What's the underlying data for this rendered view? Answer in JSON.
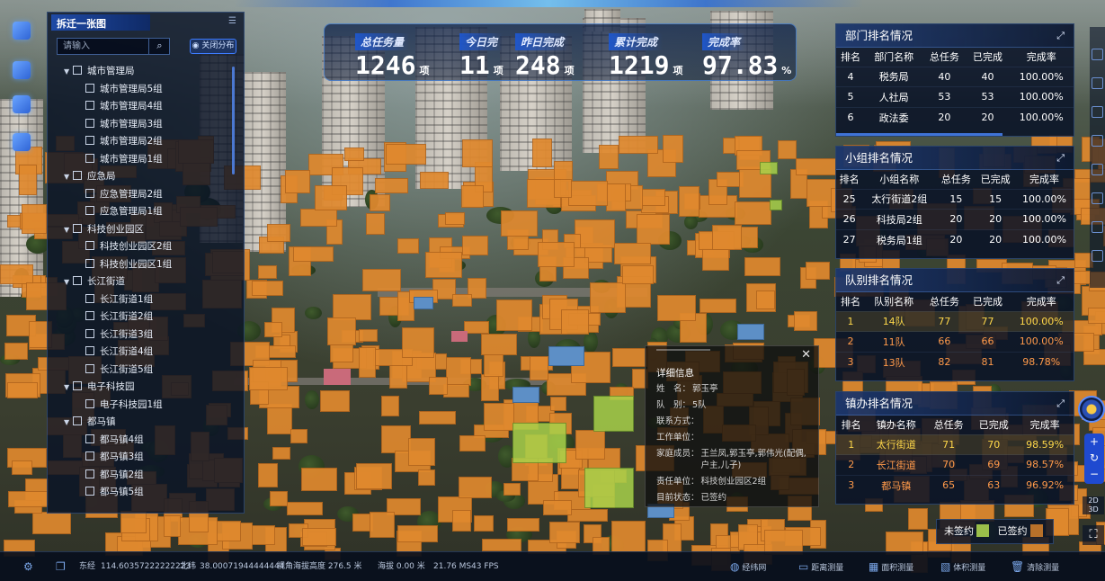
{
  "stats": {
    "items": [
      {
        "label": "总任务量",
        "value": "1246",
        "unit": "项"
      },
      {
        "label": "今日完",
        "value": "11",
        "unit": "项"
      },
      {
        "label": "昨日完成",
        "value": "248",
        "unit": "项"
      },
      {
        "label": "累计完成",
        "value": "1219",
        "unit": "项"
      },
      {
        "label": "完成率",
        "value": "97.83",
        "unit": "%"
      }
    ]
  },
  "tree": {
    "title": "拆迁一张图",
    "search_placeholder": "请输入",
    "close_button": "关闭分布",
    "groups": [
      {
        "label": "城市管理局",
        "children": [
          "城市管理局5组",
          "城市管理局4组",
          "城市管理局3组",
          "城市管理局2组",
          "城市管理局1组"
        ]
      },
      {
        "label": "应急局",
        "children": [
          "应急管理局2组",
          "应急管理局1组"
        ]
      },
      {
        "label": "科技创业园区",
        "children": [
          "科技创业园区2组",
          "科技创业园区1组"
        ]
      },
      {
        "label": "长江街道",
        "children": [
          "长江街道1组",
          "长江街道2组",
          "长江街道3组",
          "长江街道4组",
          "长江街道5组"
        ]
      },
      {
        "label": "电子科技园",
        "children": [
          "电子科技园1组"
        ]
      },
      {
        "label": "都马镇",
        "children": [
          "都马镇4组",
          "都马镇3组",
          "都马镇2组",
          "都马镇5组"
        ]
      }
    ]
  },
  "dept_rank": {
    "title": "部门排名情况",
    "headers": [
      "排名",
      "部门名称",
      "总任务",
      "已完成",
      "完成率"
    ],
    "rows": [
      [
        "4",
        "税务局",
        "40",
        "40",
        "100.00%"
      ],
      [
        "5",
        "人社局",
        "53",
        "53",
        "100.00%"
      ],
      [
        "6",
        "政法委",
        "20",
        "20",
        "100.00%"
      ]
    ]
  },
  "group_rank": {
    "title": "小组排名情况",
    "headers": [
      "排名",
      "小组名称",
      "总任务",
      "已完成",
      "完成率"
    ],
    "rows": [
      [
        "25",
        "太行街道2组",
        "15",
        "15",
        "100.00%"
      ],
      [
        "26",
        "科技局2组",
        "20",
        "20",
        "100.00%"
      ],
      [
        "27",
        "税务局1组",
        "20",
        "20",
        "100.00%"
      ]
    ]
  },
  "team_rank": {
    "title": "队别排名情况",
    "headers": [
      "排名",
      "队别名称",
      "总任务",
      "已完成",
      "完成率"
    ],
    "rows": [
      [
        "1",
        "14队",
        "77",
        "77",
        "100.00%"
      ],
      [
        "2",
        "11队",
        "66",
        "66",
        "100.00%"
      ],
      [
        "3",
        "13队",
        "82",
        "81",
        "98.78%"
      ]
    ]
  },
  "town_rank": {
    "title": "镇办排名情况",
    "headers": [
      "排名",
      "镇办名称",
      "总任务",
      "已完成",
      "完成率"
    ],
    "rows": [
      [
        "1",
        "太行街道",
        "71",
        "70",
        "98.59%"
      ],
      [
        "2",
        "长江街道",
        "70",
        "69",
        "98.57%"
      ],
      [
        "3",
        "都马镇",
        "65",
        "63",
        "96.92%"
      ]
    ]
  },
  "detail": {
    "title": "详细信息",
    "fields": [
      {
        "label": "姓　名：",
        "value": "郭玉亭"
      },
      {
        "label": "队　别：",
        "value": "5队"
      },
      {
        "label": "联系方式：",
        "value": ""
      },
      {
        "label": "工作单位：",
        "value": ""
      },
      {
        "label": "家庭成员：",
        "value": "王兰凤,郭玉亭,郭伟光(配偶,户主,儿子)"
      },
      {
        "label": "责任单位：",
        "value": "科技创业园区2组"
      },
      {
        "label": "目前状态：",
        "value": "已签约"
      }
    ]
  },
  "legend": {
    "unsigned_label": "未签约",
    "unsigned_color": "#9bbf4a",
    "signed_label": "已签约",
    "signed_color": "#b8712a"
  },
  "status_bar": {
    "lon_label": "东经",
    "lon_value": "114.60357222222223",
    "lat_label": "北纬",
    "lat_value": "38.00071944444444",
    "view_alt": "视角海拔高度 276.5 米",
    "alt": "海拔 0.00 米",
    "ms": "21.76 MS",
    "fps": "43 FPS",
    "tools": [
      "经纬网",
      "距离测量",
      "面积测量",
      "体积测量",
      "清除测量"
    ]
  },
  "colors": {
    "accent": "#2f64d6",
    "house_orange": "#e0892e",
    "house_green": "#a8d14a",
    "gold": "#ffd84a",
    "orange_text": "#ff9a4a"
  }
}
